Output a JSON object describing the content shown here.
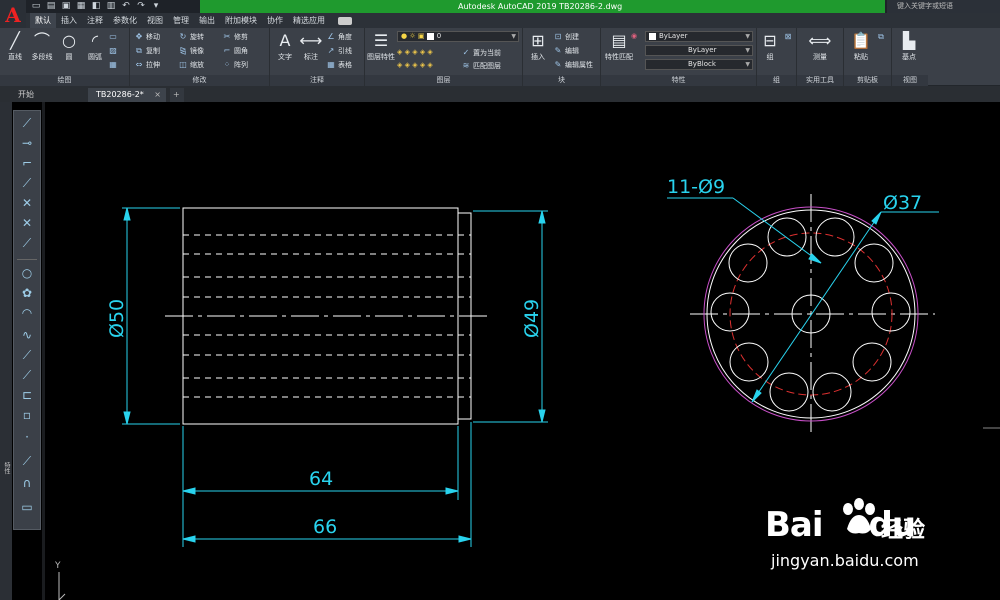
{
  "window": {
    "title": "Autodesk AutoCAD 2019    TB20286-2.dwg",
    "search_placeholder": "键入关键字或短语",
    "title_color": "#1f9a2e"
  },
  "menu": {
    "tabs": [
      "默认",
      "插入",
      "注释",
      "参数化",
      "视图",
      "管理",
      "输出",
      "附加模块",
      "协作",
      "精选应用"
    ],
    "active": "默认"
  },
  "ribbon": {
    "draw": {
      "title": "绘图",
      "line": "直线",
      "polyline": "多段线",
      "circle": "圆",
      "arc": "圆弧"
    },
    "modify": {
      "title": "修改",
      "move": "移动",
      "rotate": "旋转",
      "trim": "修剪",
      "copy": "复制",
      "mirror": "镜像",
      "fillet": "圆角",
      "stretch": "拉伸",
      "scale": "缩放",
      "array": "阵列"
    },
    "annotation": {
      "title": "注释",
      "text": "文字",
      "dimension": "标注",
      "angle": "角度",
      "leader": "引线",
      "table": "表格"
    },
    "layers": {
      "title": "图层",
      "layer_props": "图层特性",
      "current_layer": "0",
      "make_current": "置为当前",
      "match_layer": "匹配图层"
    },
    "block": {
      "title": "块",
      "insert": "插入",
      "create": "创建",
      "edit": "编辑",
      "edit_attrs": "编辑属性"
    },
    "properties": {
      "title": "特性",
      "match": "特性匹配",
      "color": "ByLayer",
      "linetype": "ByLayer",
      "lineweight": "ByBlock"
    },
    "groups": {
      "title": "组",
      "group": "组"
    },
    "utilities": {
      "title": "实用工具",
      "measure": "测量"
    },
    "clipboard": {
      "title": "剪贴板",
      "paste": "粘贴"
    },
    "view": {
      "title": "视图",
      "base": "基点"
    }
  },
  "doc_tabs": {
    "start": "开始",
    "file": "TB20286-2*",
    "add": "+"
  },
  "side_palette_label": "特性",
  "drawing": {
    "dim_length_inner": "64",
    "dim_length_outer": "66",
    "dim_dia_left": "Ø50",
    "dim_dia_right": "Ø49",
    "dim_holes": "11-Ø9",
    "dim_pitch": "Ø37",
    "line_color": "#ffffff",
    "dim_color": "#29d3ee",
    "circle_color": "#c850c8",
    "hidden_color": "#dd3030"
  },
  "ucs_y": "Y",
  "watermark": {
    "brand_a": "Bai",
    "brand_b": "du",
    "sub": "经验",
    "url": "jingyan.baidu.com"
  }
}
